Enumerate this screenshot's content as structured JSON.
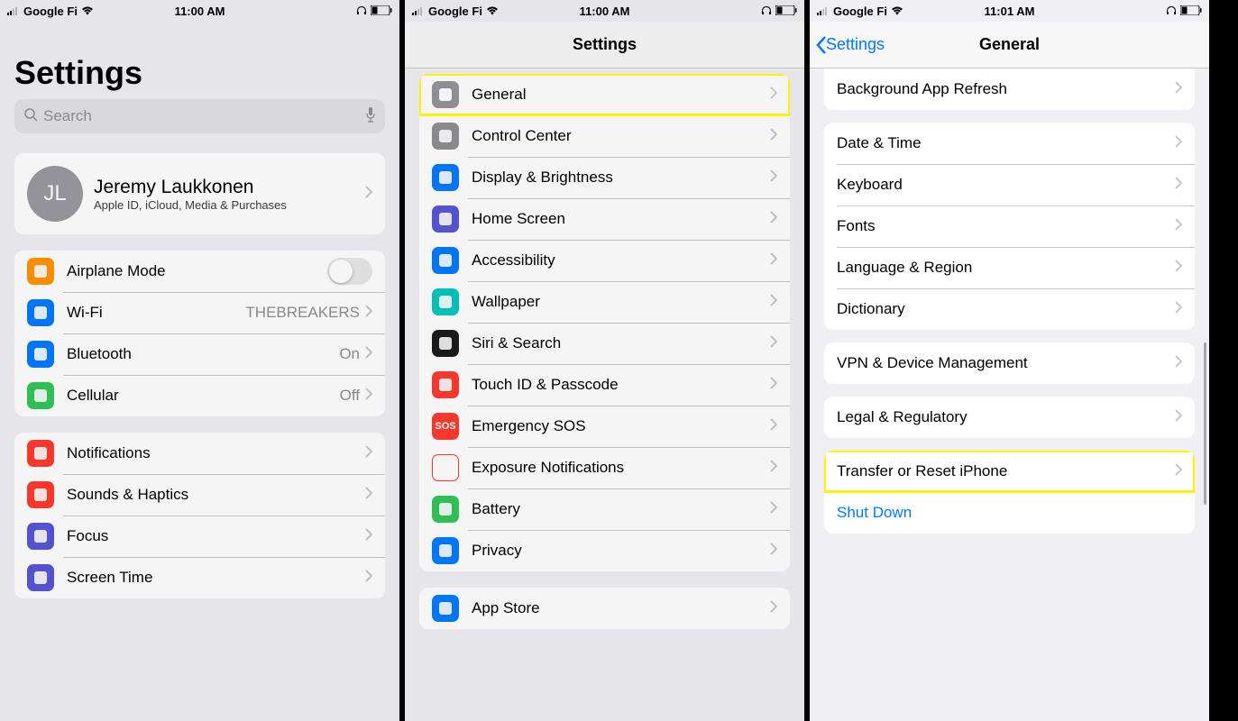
{
  "status1": {
    "carrier": "Google Fi",
    "time": "11:00 AM"
  },
  "status2": {
    "carrier": "Google Fi",
    "time": "11:00 AM"
  },
  "status3": {
    "carrier": "Google Fi",
    "time": "11:01 AM"
  },
  "p1": {
    "title": "Settings",
    "search_ph": "Search",
    "profile": {
      "initials": "JL",
      "name": "Jeremy Laukkonen",
      "sub": "Apple ID, iCloud, Media & Purchases"
    },
    "g1": [
      {
        "label": "Airplane Mode",
        "color": "#ff9500",
        "type": "toggle"
      },
      {
        "label": "Wi-Fi",
        "color": "#007aff",
        "value": "THEBREAKERS"
      },
      {
        "label": "Bluetooth",
        "color": "#007aff",
        "value": "On"
      },
      {
        "label": "Cellular",
        "color": "#34c759",
        "value": "Off"
      }
    ],
    "g2": [
      {
        "label": "Notifications",
        "color": "#ff3b30"
      },
      {
        "label": "Sounds & Haptics",
        "color": "#ff3b30"
      },
      {
        "label": "Focus",
        "color": "#5856d6"
      },
      {
        "label": "Screen Time",
        "color": "#5856d6"
      }
    ]
  },
  "p2": {
    "title": "Settings",
    "items": [
      {
        "label": "General",
        "color": "#8e8e93",
        "hl": true
      },
      {
        "label": "Control Center",
        "color": "#8e8e93"
      },
      {
        "label": "Display & Brightness",
        "color": "#007aff"
      },
      {
        "label": "Home Screen",
        "color": "#5856d6"
      },
      {
        "label": "Accessibility",
        "color": "#007aff"
      },
      {
        "label": "Wallpaper",
        "color": "#00c7be"
      },
      {
        "label": "Siri & Search",
        "color": "#1c1c1e"
      },
      {
        "label": "Touch ID & Passcode",
        "color": "#ff3b30"
      },
      {
        "label": "Emergency SOS",
        "color": "#ff3b30",
        "text": "SOS"
      },
      {
        "label": "Exposure Notifications",
        "color": "#ffffff",
        "outline": true
      },
      {
        "label": "Battery",
        "color": "#34c759"
      },
      {
        "label": "Privacy",
        "color": "#007aff"
      }
    ],
    "extra": [
      {
        "label": "App Store",
        "color": "#007aff"
      }
    ]
  },
  "p3": {
    "back": "Settings",
    "title": "General",
    "g0": [
      {
        "label": "Background App Refresh"
      }
    ],
    "g1": [
      {
        "label": "Date & Time"
      },
      {
        "label": "Keyboard"
      },
      {
        "label": "Fonts"
      },
      {
        "label": "Language & Region"
      },
      {
        "label": "Dictionary"
      }
    ],
    "g2": [
      {
        "label": "VPN & Device Management"
      }
    ],
    "g3": [
      {
        "label": "Legal & Regulatory"
      }
    ],
    "g4": [
      {
        "label": "Transfer or Reset iPhone",
        "hl": true
      },
      {
        "label": "Shut Down",
        "blue": true
      }
    ]
  }
}
